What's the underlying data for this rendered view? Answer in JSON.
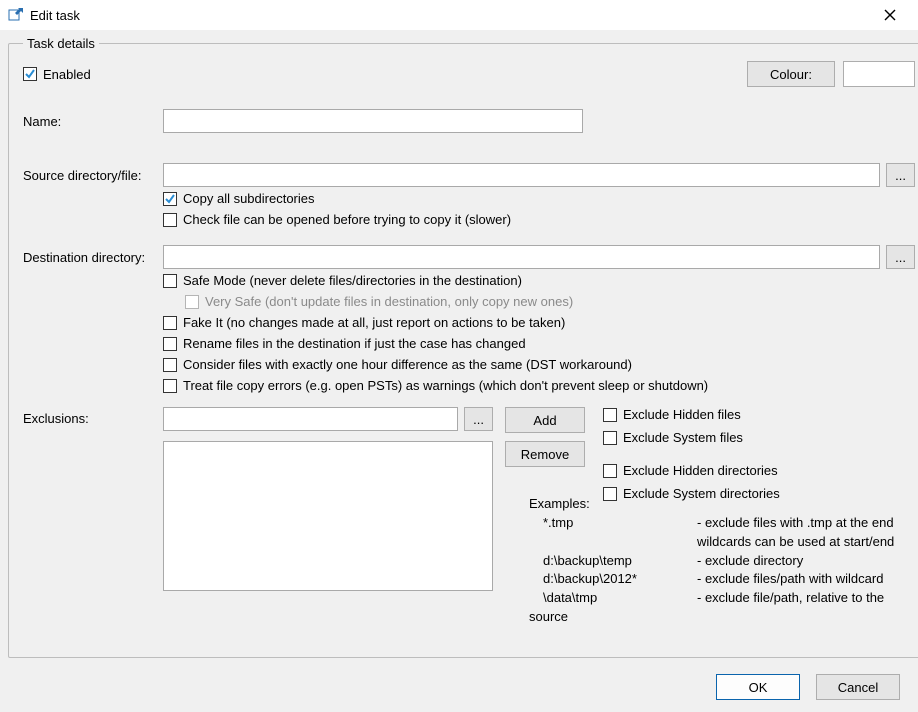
{
  "window": {
    "title": "Edit task"
  },
  "groupbox": {
    "legend": "Task details"
  },
  "enabled": {
    "label": "Enabled",
    "checked": true
  },
  "colour": {
    "button_label": "Colour:",
    "value": "#ffffff"
  },
  "name": {
    "label": "Name:",
    "value": ""
  },
  "source": {
    "label": "Source directory/file:",
    "value": "",
    "browse": "...",
    "copy_all_sub": {
      "label": "Copy all subdirectories",
      "checked": true
    },
    "check_open": {
      "label": "Check file can be opened before trying to copy it (slower)",
      "checked": false
    }
  },
  "dest": {
    "label": "Destination directory:",
    "value": "",
    "browse": "...",
    "safe_mode": {
      "label": "Safe Mode (never delete files/directories in the destination)",
      "checked": false
    },
    "very_safe": {
      "label": "Very Safe (don't update files in destination, only copy new ones)",
      "checked": false,
      "enabled": false
    },
    "fake_it": {
      "label": "Fake It (no changes made at all, just report on actions to be taken)",
      "checked": false
    },
    "rename_case": {
      "label": "Rename files in the destination if just the case has changed",
      "checked": false
    },
    "dst_workaround": {
      "label": "Consider files with exactly one hour difference as the same (DST workaround)",
      "checked": false
    },
    "treat_errors_warnings": {
      "label": "Treat file copy errors (e.g. open PSTs) as warnings (which don't prevent sleep or shutdown)",
      "checked": false
    }
  },
  "exclusions": {
    "label": "Exclusions:",
    "input_value": "",
    "browse": "...",
    "add": "Add",
    "remove": "Remove",
    "exclude_hidden_files": {
      "label": "Exclude Hidden files",
      "checked": false
    },
    "exclude_system_files": {
      "label": "Exclude System files",
      "checked": false
    },
    "exclude_hidden_dirs": {
      "label": "Exclude Hidden directories",
      "checked": false
    },
    "exclude_system_dirs": {
      "label": "Exclude System directories",
      "checked": false
    },
    "examples": {
      "header": "Examples:",
      "rows": [
        {
          "pattern": "*.tmp",
          "desc": "- exclude files with .tmp at the end wildcards can be used at start/end"
        },
        {
          "pattern": "d:\\backup\\temp",
          "desc": "- exclude directory"
        },
        {
          "pattern": "d:\\backup\\2012*",
          "desc": "- exclude files/path with wildcard"
        },
        {
          "pattern": "\\data\\tmp",
          "desc": "- exclude file/path, relative to the"
        }
      ],
      "source_tail": "source"
    }
  },
  "buttons": {
    "ok": "OK",
    "cancel": "Cancel"
  }
}
